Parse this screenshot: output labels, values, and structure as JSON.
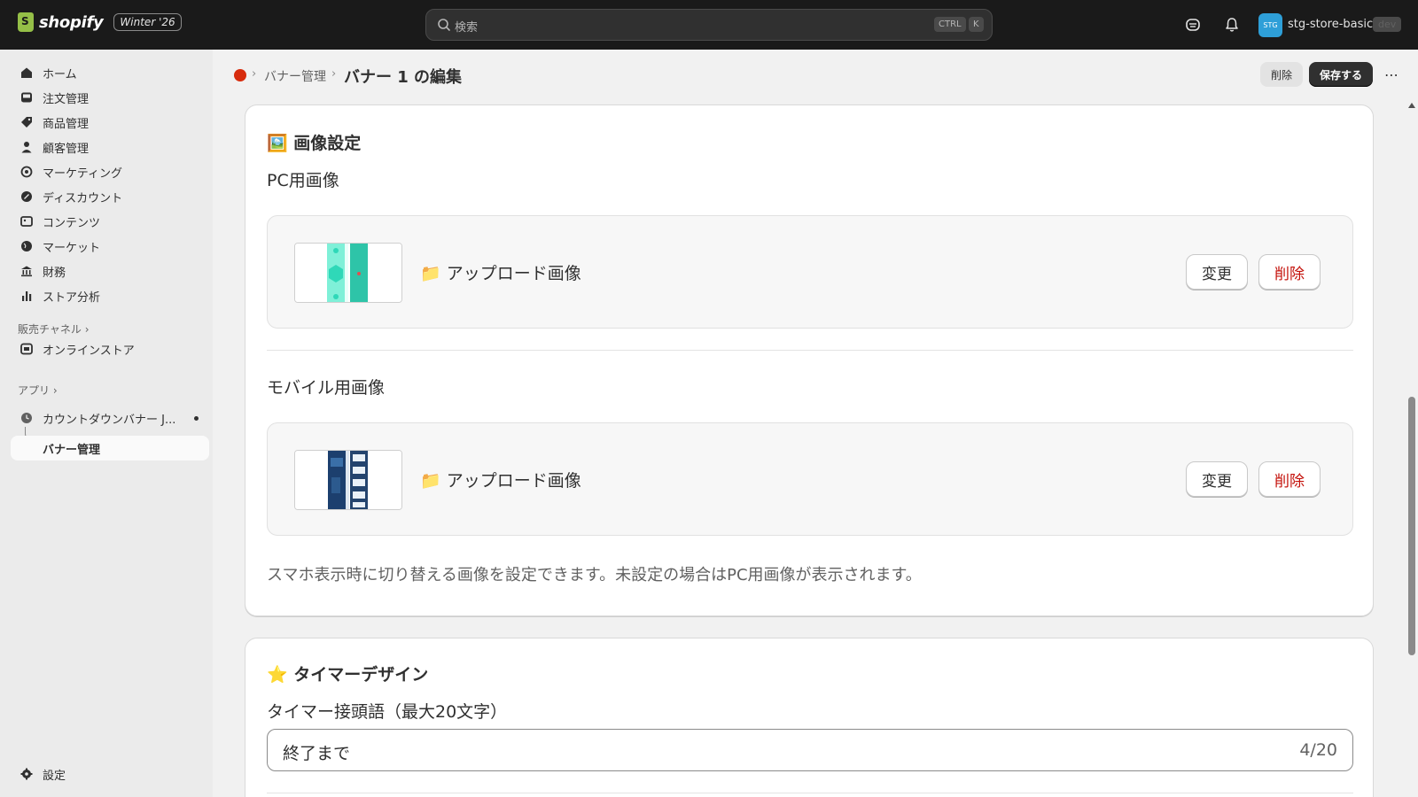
{
  "topbar": {
    "logo_text": "shopify",
    "edition_badge": "Winter '26",
    "search_placeholder": "検索",
    "shortcut_ctrl": "CTRL",
    "shortcut_k": "K",
    "store_initials": "STG",
    "store_name": "stg-store-basic",
    "env_badge": "dev"
  },
  "sidebar": {
    "items": [
      {
        "label": "ホーム",
        "icon": "home-icon"
      },
      {
        "label": "注文管理",
        "icon": "inbox-icon"
      },
      {
        "label": "商品管理",
        "icon": "tag-icon"
      },
      {
        "label": "顧客管理",
        "icon": "person-icon"
      },
      {
        "label": "マーケティング",
        "icon": "target-icon"
      },
      {
        "label": "ディスカウント",
        "icon": "discount-icon"
      },
      {
        "label": "コンテンツ",
        "icon": "image-icon"
      },
      {
        "label": "マーケット",
        "icon": "globe-icon"
      },
      {
        "label": "財務",
        "icon": "bank-icon"
      },
      {
        "label": "ストア分析",
        "icon": "chart-icon"
      }
    ],
    "sales_channels_label": "販売チャネル",
    "online_store_label": "オンラインストア",
    "apps_label": "アプリ",
    "app_name": "カウントダウンバナー J...",
    "app_sub_item": "バナー管理",
    "settings_label": "設定"
  },
  "header": {
    "breadcrumb_link": "バナー管理",
    "title": "バナー 1 の編集",
    "delete_label": "削除",
    "save_label": "保存する",
    "more_label": "⋯"
  },
  "image_settings": {
    "title": "画像設定",
    "title_emoji": "🖼️",
    "pc_label": "PC用画像",
    "mobile_label": "モバイル用画像",
    "upload_folder_emoji": "📁",
    "upload_label": "アップロード画像",
    "change_label": "変更",
    "delete_label": "削除",
    "help_text": "スマホ表示時に切り替える画像を設定できます。未設定の場合はPC用画像が表示されます。"
  },
  "timer_design": {
    "title": "タイマーデザイン",
    "title_emoji": "⭐",
    "prefix_label": "タイマー接頭語（最大20文字）",
    "prefix_value": "終了まで",
    "prefix_count": "4/20"
  },
  "colors": {
    "topbar_bg": "#1a1a1a",
    "primary_button": "#303030",
    "critical_text": "#c4120b",
    "store_avatar": "#2e9fd8"
  }
}
